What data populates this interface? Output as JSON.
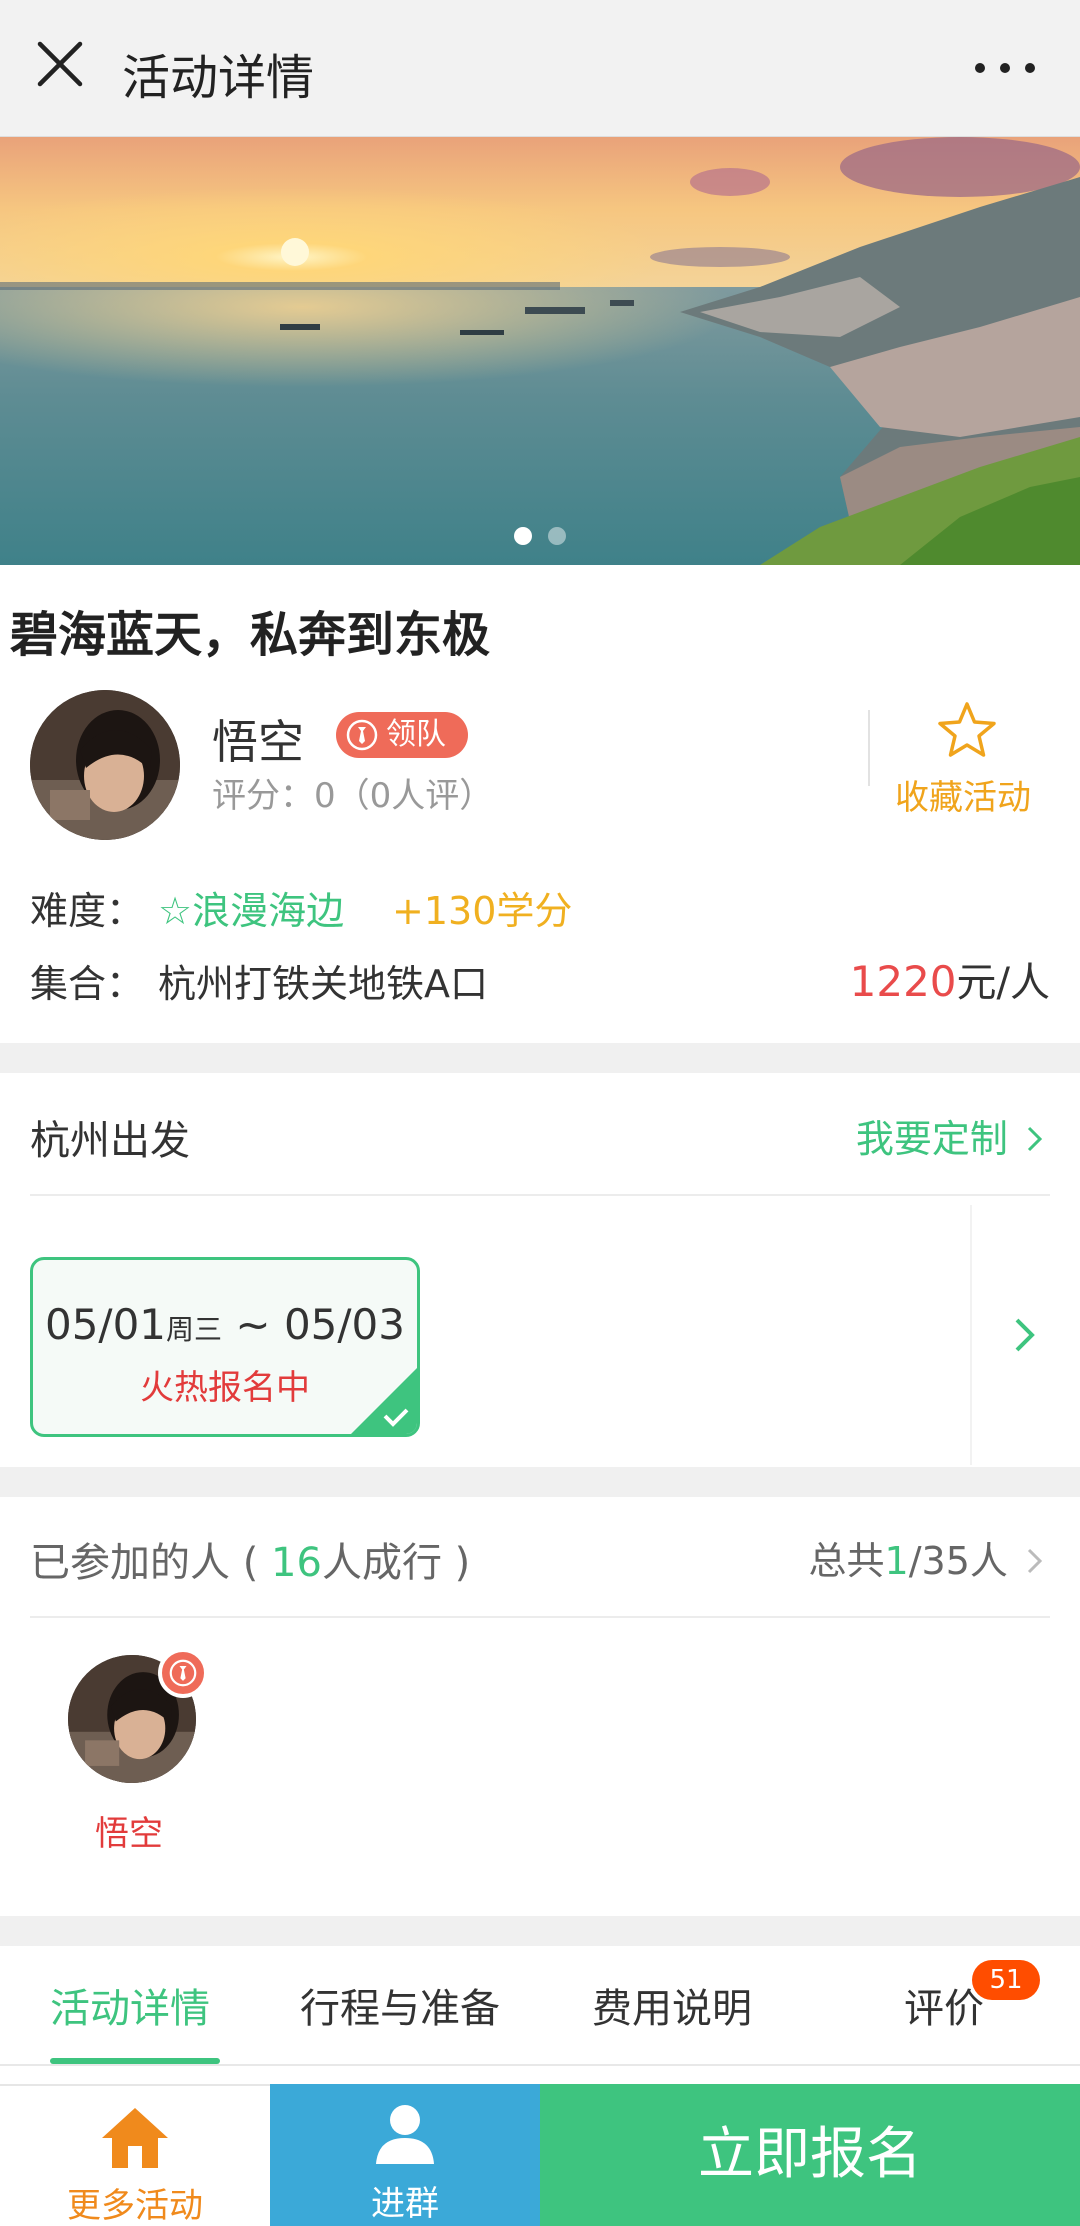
{
  "header": {
    "title": "活动详情",
    "close_icon": "close-icon",
    "more_icon": "more-icon"
  },
  "banner": {
    "image": "sunset-sea-cliff",
    "slide_count": 2,
    "active_slide": 1
  },
  "activity": {
    "title": "碧海蓝天，私奔到东极",
    "leader": {
      "name": "悟空",
      "role_badge": "领队",
      "score": "评分：0（0人评）"
    },
    "favorite_label": "收藏活动",
    "difficulty_label": "难度：",
    "difficulty_value": "☆浪漫海边",
    "credit": "+130学分",
    "meeting_label": "集合：",
    "meeting_value": "杭州打铁关地铁A口",
    "price_number": "1220",
    "price_unit": "元/人"
  },
  "departure": {
    "title": "杭州出发",
    "custom_link": "我要定制",
    "date_start": "05/01",
    "date_weekday": "周三",
    "date_sep": " ~ ",
    "date_end": "05/03",
    "status": "火热报名中"
  },
  "participants": {
    "title_prefix": "已参加的人 ( ",
    "count": "16",
    "title_suffix": "人成行 )",
    "total_prefix": "总共",
    "total_joined": "1",
    "total_suffix": "/35人",
    "people": [
      {
        "name": "悟空",
        "is_leader": true
      }
    ]
  },
  "tabs": {
    "items": [
      "活动详情",
      "行程与准备",
      "费用说明",
      "评价"
    ],
    "active_index": 0,
    "review_count": "51"
  },
  "bottom_bar": {
    "more_label": "更多活动",
    "group_label": "进群",
    "signup_label": "立即报名"
  },
  "colors": {
    "accent": "#3ec47f",
    "price": "#e94b4b",
    "gold": "#f0a41c",
    "blue": "#3ba9d8",
    "leader_badge": "#ef6b59"
  }
}
